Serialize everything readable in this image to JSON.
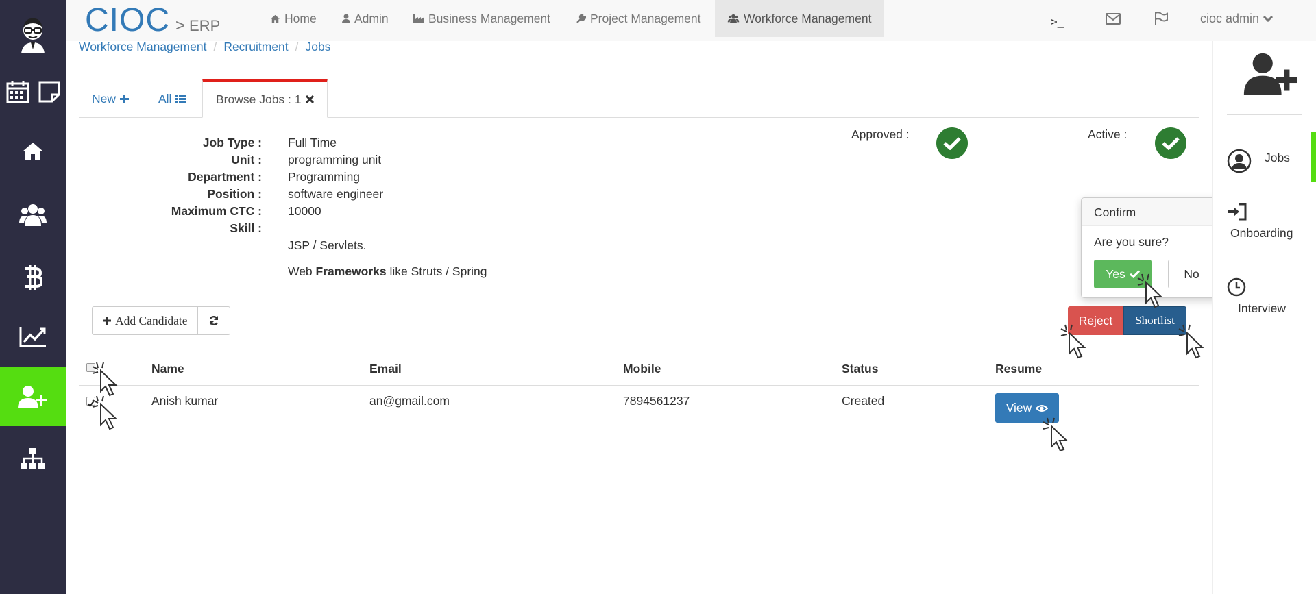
{
  "brand": {
    "main": "CIOC",
    "separator": ">",
    "sub": "ERP"
  },
  "topnav": {
    "items": [
      {
        "label": "Home",
        "icon": "home-icon"
      },
      {
        "label": "Admin",
        "icon": "user-icon"
      },
      {
        "label": "Business Management",
        "icon": "industry-icon"
      },
      {
        "label": "Project Management",
        "icon": "wrench-icon"
      },
      {
        "label": "Workforce Management",
        "icon": "users-icon",
        "active": true
      }
    ],
    "terminal": ">_",
    "user": "cioc admin"
  },
  "sidebar": {
    "items": [
      "avatar",
      "calendar-icon",
      "note-icon",
      "home-icon",
      "users-icon",
      "bitcoin-icon",
      "chart-line-icon",
      "user-plus-icon",
      "sitemap-icon"
    ],
    "active": "user-plus-icon"
  },
  "breadcrumb": [
    "Workforce Management",
    "Recruitment",
    "Jobs"
  ],
  "tabs": [
    {
      "label": "New"
    },
    {
      "label": "All"
    },
    {
      "label": "Browse Jobs : 1",
      "active": true
    }
  ],
  "job": {
    "fields": [
      {
        "label": "Job Type :",
        "value": "Full Time"
      },
      {
        "label": "Unit :",
        "value": "programming unit"
      },
      {
        "label": "Department :",
        "value": "Programming"
      },
      {
        "label": "Position :",
        "value": "software engineer"
      },
      {
        "label": "Maximum CTC :",
        "value": "10000"
      },
      {
        "label": "Skill :",
        "value": ""
      }
    ],
    "skill_lines": {
      "line1": "JSP / Servlets.",
      "line2_prefix": "Web ",
      "line2_bold": "Frameworks",
      "line2_suffix": " like Struts / Spring"
    },
    "approved_label": "Approved :",
    "active_label": "Active :"
  },
  "actions": {
    "add_candidate": "Add Candidate",
    "reject": "Reject",
    "shortlist": "Shortlist"
  },
  "confirm": {
    "title": "Confirm",
    "question": "Are you sure?",
    "yes": "Yes",
    "no": "No"
  },
  "table": {
    "headers": [
      "Name",
      "Email",
      "Mobile",
      "Status",
      "Resume"
    ],
    "rows": [
      {
        "name": "Anish kumar",
        "email": "an@gmail.com",
        "mobile": "7894561237",
        "status": "Created",
        "resume": "View",
        "checked": true
      }
    ]
  },
  "right_panel": {
    "items": [
      "Jobs",
      "Onboarding",
      "Interview"
    ]
  },
  "colors": {
    "sidebar_bg": "#2d2d42",
    "accent_green": "#55dd11",
    "link_blue": "#337ab7",
    "danger": "#d9534f",
    "success": "#5cb85c",
    "check_green": "#2e7d32"
  }
}
